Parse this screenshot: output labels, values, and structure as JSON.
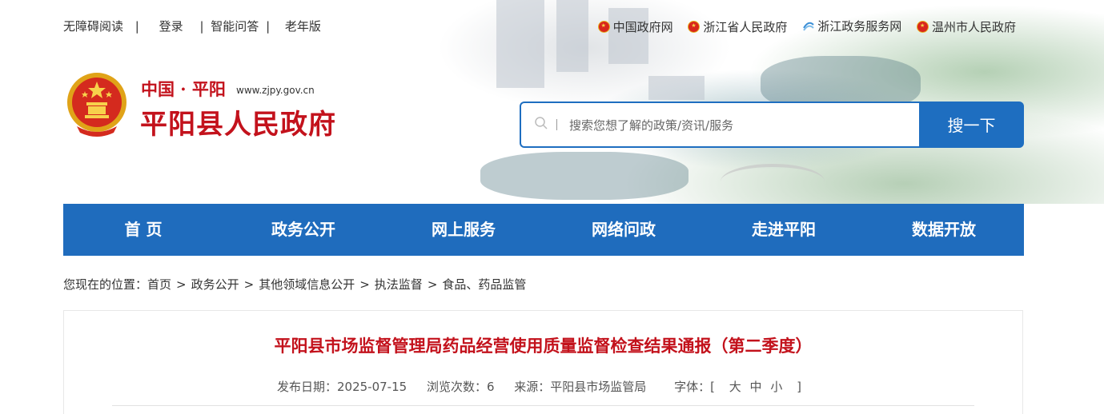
{
  "topbar": {
    "accessibility": "无障碍阅读",
    "sep1": "|",
    "login": "登录",
    "sep2": "|",
    "qa": "智能问答",
    "sep3": "|",
    "elderly": "老年版",
    "links": [
      {
        "label": "中国政府网",
        "icon": "national-emblem-icon"
      },
      {
        "label": "浙江省人民政府",
        "icon": "national-emblem-icon"
      },
      {
        "label": "浙江政务服务网",
        "icon": "zjzw-logo-icon"
      },
      {
        "label": "温州市人民政府",
        "icon": "national-emblem-icon"
      }
    ]
  },
  "brand": {
    "region": "中国 · 平阳",
    "url": "www.zjpy.gov.cn",
    "title": "平阳县人民政府",
    "emblem": "national-emblem"
  },
  "search": {
    "placeholder": "搜索您想了解的政策/资讯/服务",
    "button": "搜一下"
  },
  "nav": [
    "首 页",
    "政务公开",
    "网上服务",
    "网络问政",
    "走进平阳",
    "数据开放"
  ],
  "breadcrumb": {
    "prefix": "您现在的位置：",
    "items": [
      "首页",
      "政务公开",
      "其他领域信息公开",
      "执法监督",
      "食品、药品监管"
    ],
    "separator": ">"
  },
  "article": {
    "title": "平阳县市场监督管理局药品经营使用质量监督检查结果通报（第二季度）",
    "publish_date": "发布日期：2025-07-15",
    "views": "浏览次数：6",
    "source": "来源：平阳县市场监管局",
    "font_size_label": "字体：[",
    "font_large": "大",
    "font_medium": "中",
    "font_small": "小",
    "font_close": "]"
  },
  "colors": {
    "brand_red": "#c3121c",
    "nav_blue": "#1f6cbd",
    "search_blue": "#1e6ec0"
  }
}
